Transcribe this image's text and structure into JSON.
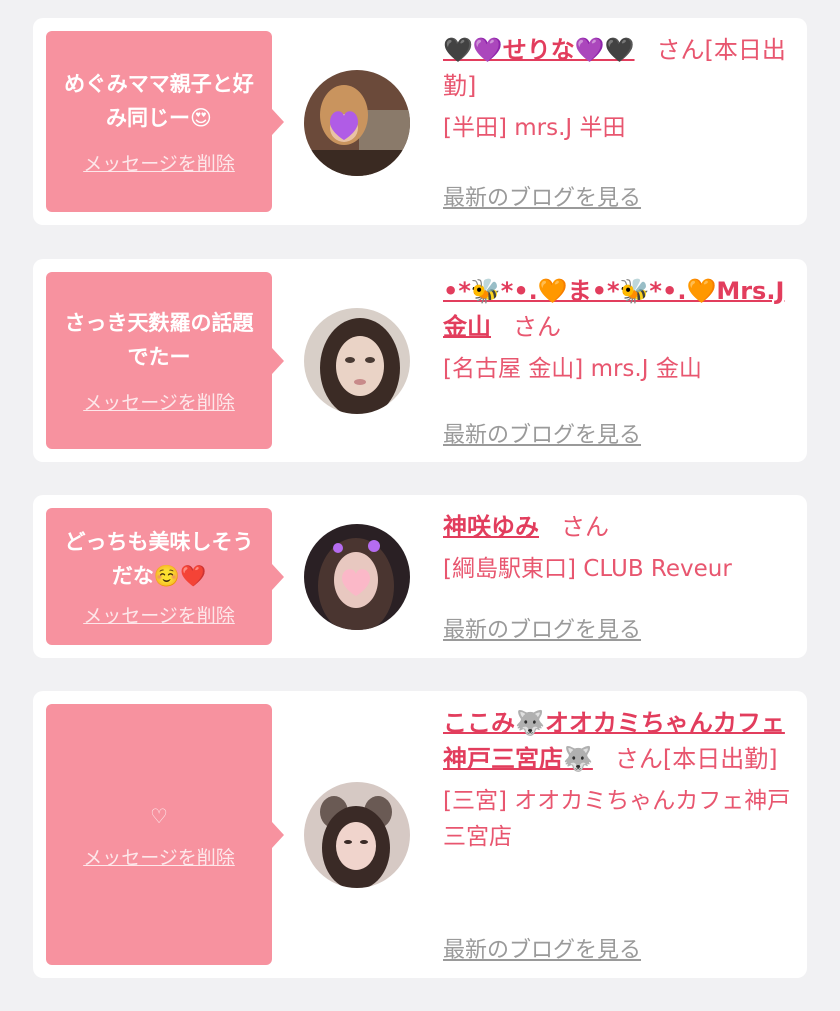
{
  "messages": [
    {
      "bubble_text": "めぐみママ親子と好み同じー😍",
      "delete_label": "メッセージを削除",
      "name": "🖤💜せりな💜🖤",
      "honorific": "さん",
      "status": "[本日出勤]",
      "shop": "[半田] mrs.J 半田",
      "blog_label": "最新のブログを見る"
    },
    {
      "bubble_text": "さっき天麩羅の話題でたー",
      "delete_label": "メッセージを削除",
      "name": "•*🐝*•.🧡ま•*🐝*•.🧡Mrs.J金山",
      "honorific": "さん",
      "status": "",
      "shop": "[名古屋 金山] mrs.J 金山",
      "blog_label": "最新のブログを見る"
    },
    {
      "bubble_text": "どっちも美味しそうだな☺️❤️",
      "delete_label": "メッセージを削除",
      "name": "神咲ゆみ",
      "honorific": "さん",
      "status": "",
      "shop": "[綱島駅東口] CLUB Reveur",
      "blog_label": "最新のブログを見る"
    },
    {
      "bubble_text": "♡",
      "delete_label": "メッセージを削除",
      "name": "ここみ🐺オオカミちゃんカフェ神戸三宮店🐺",
      "honorific": "さん",
      "status": "[本日出勤]",
      "shop": "[三宮] オオカミちゃんカフェ神戸三宮店",
      "blog_label": "最新のブログを見る"
    }
  ],
  "colors": {
    "background": "#f1f1f3",
    "bubble": "#f7929f",
    "name_link": "#e23d5d",
    "shop_text": "#e8566f",
    "blog_link": "#9a9a9a"
  }
}
